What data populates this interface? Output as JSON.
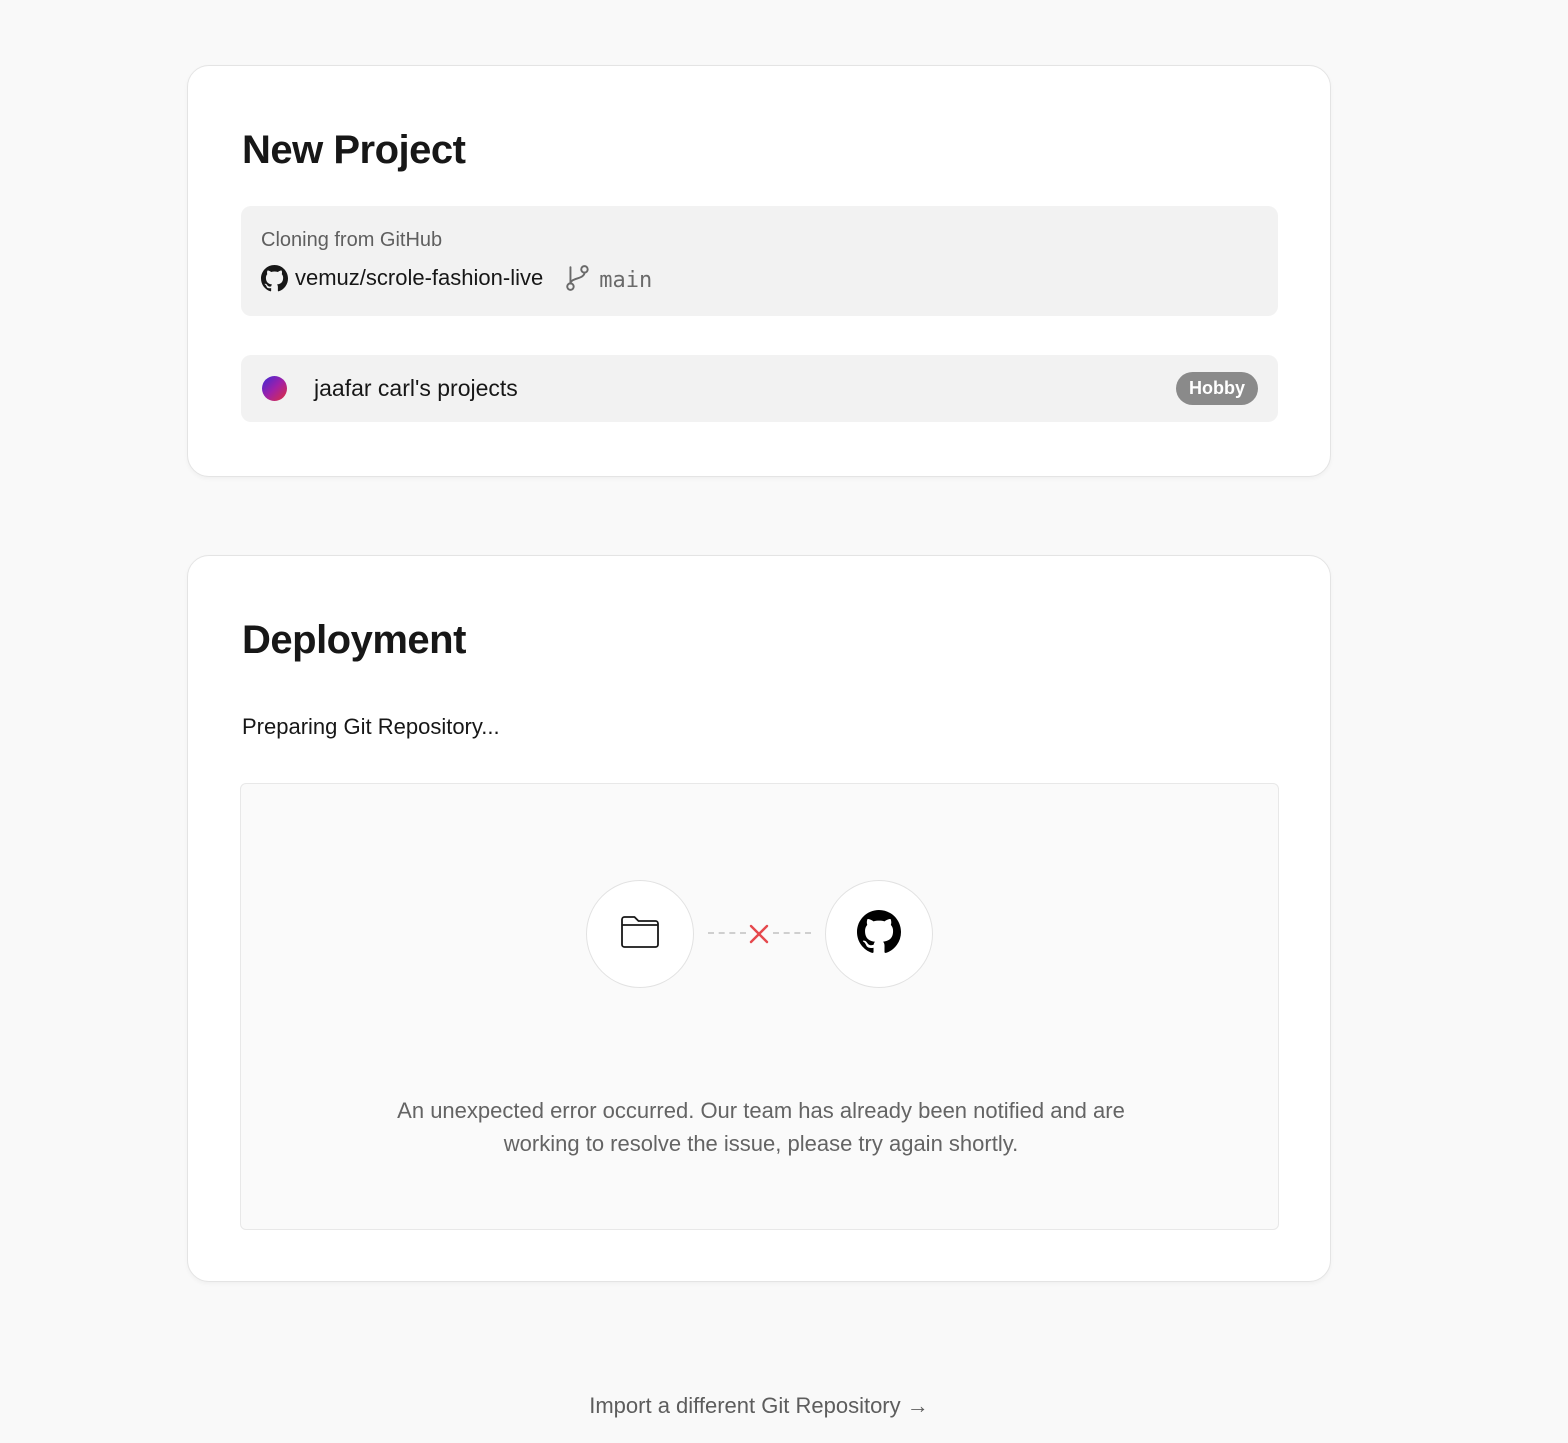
{
  "new_project": {
    "title": "New Project",
    "repo": {
      "caption": "Cloning from GitHub",
      "name": "vemuz/scrole-fashion-live",
      "branch": "main",
      "icon": "github-icon",
      "branch_icon": "git-branch-icon"
    },
    "team": {
      "name": "jaafar carl's projects",
      "plan": "Hobby",
      "avatar_colors": [
        "#3b2bd6",
        "#a020a8",
        "#e0303a"
      ]
    }
  },
  "deployment": {
    "title": "Deployment",
    "status": "Preparing Git Repository...",
    "error": {
      "message": "An unexpected error occurred. Our team has already been notified and are working to resolve the issue, please try again shortly.",
      "source_icon": "folder-icon",
      "target_icon": "github-icon",
      "connection_icon": "x-icon",
      "error_color": "#e5484d"
    }
  },
  "footer": {
    "import_link": "Import a different Git Repository →"
  }
}
